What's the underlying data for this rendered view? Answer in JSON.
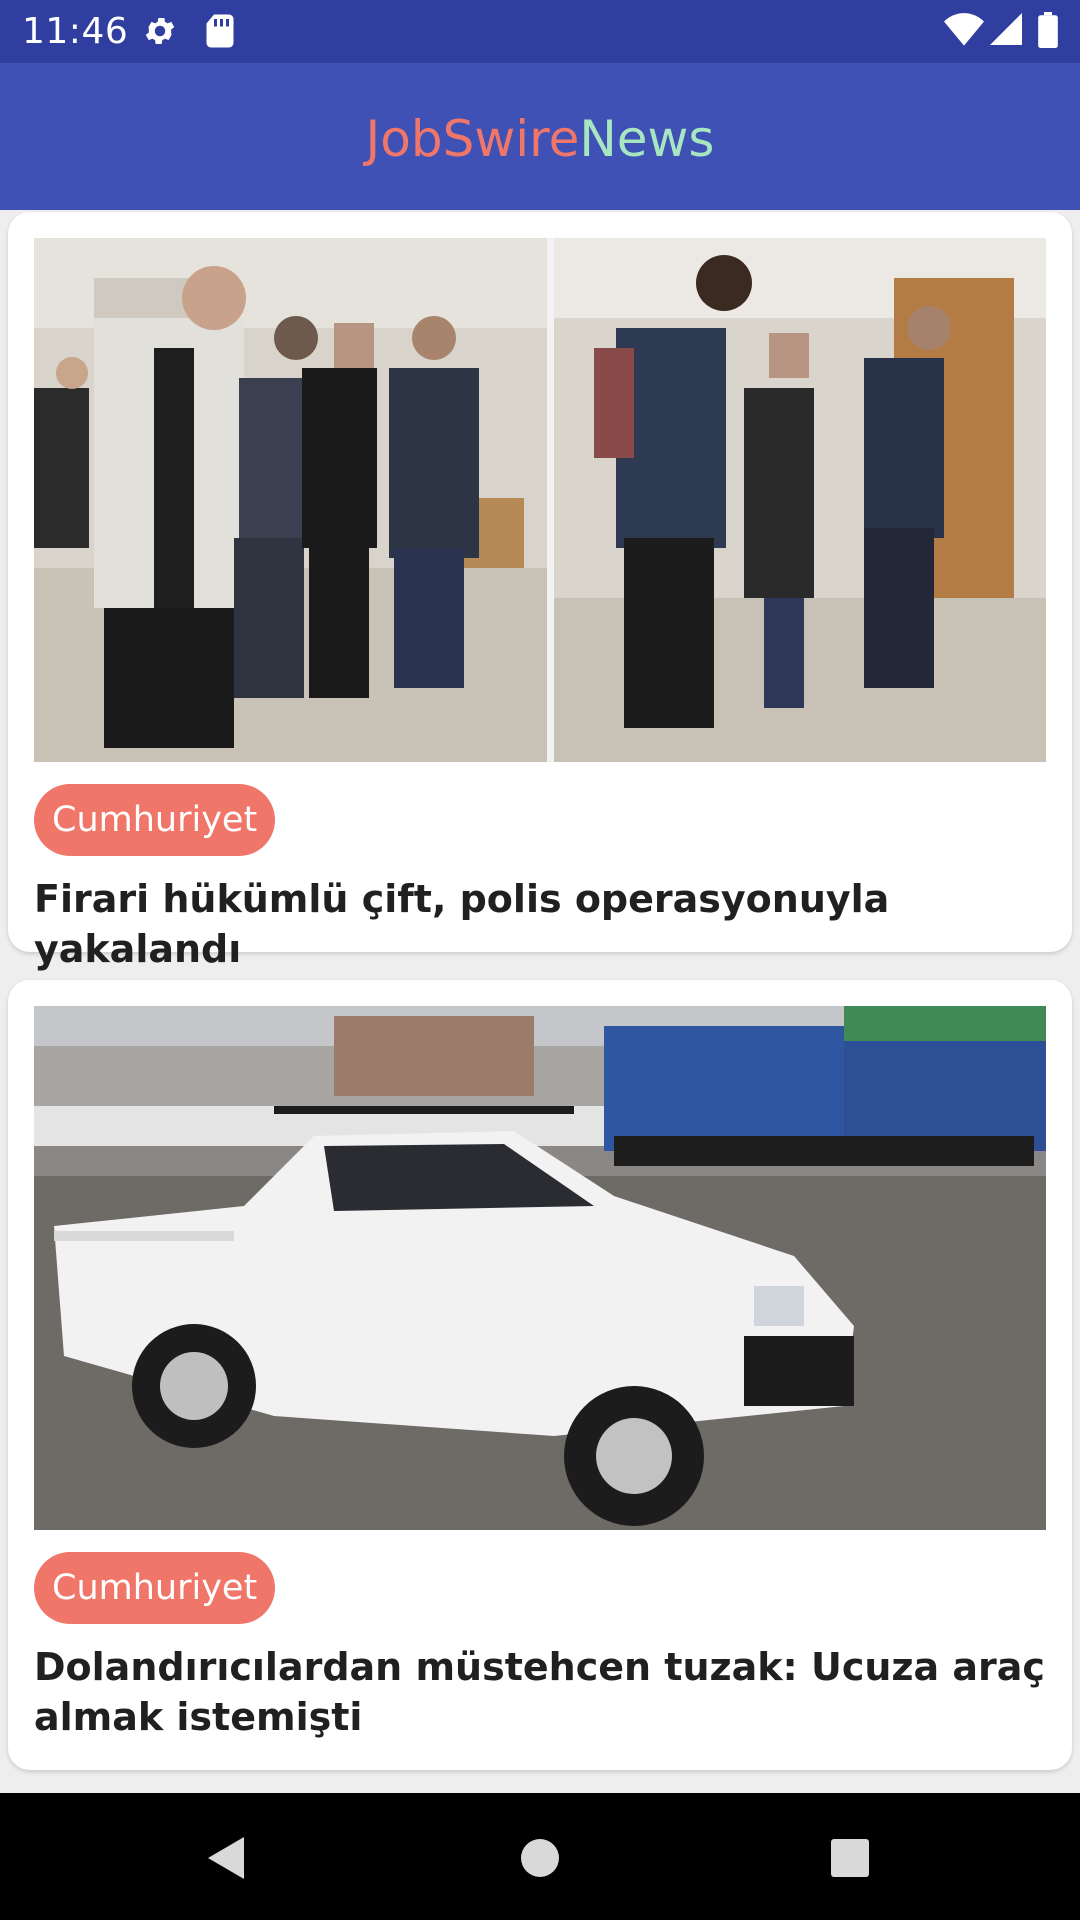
{
  "status_bar": {
    "time": "11:46",
    "left_icons": [
      "gear-icon",
      "sd-card-icon"
    ],
    "right_icons": [
      "wifi-icon",
      "cellular-signal-icon",
      "battery-icon"
    ]
  },
  "app_bar": {
    "title_part1": "JobSwire",
    "title_part2": "News",
    "background": "#3f51b5",
    "title_color_1": "#f0766a",
    "title_color_2": "#a8e6c2"
  },
  "articles": [
    {
      "source": "Cumhuriyet",
      "title": "Firari hükümlü çift, polis operasyonuyla yakalandı",
      "image": "photo-police-escort"
    },
    {
      "source": "Cumhuriyet",
      "title": "Dolandırıcılardan müstehcen tuzak: Ucuza araç almak istemişti",
      "image": "photo-white-pickup-truck"
    }
  ],
  "nav_bar": {
    "buttons": [
      "back-icon",
      "home-icon",
      "recents-icon"
    ]
  },
  "colors": {
    "status_bar": "#303f9f",
    "chip": "#f0766a",
    "background": "#eeeeee"
  }
}
